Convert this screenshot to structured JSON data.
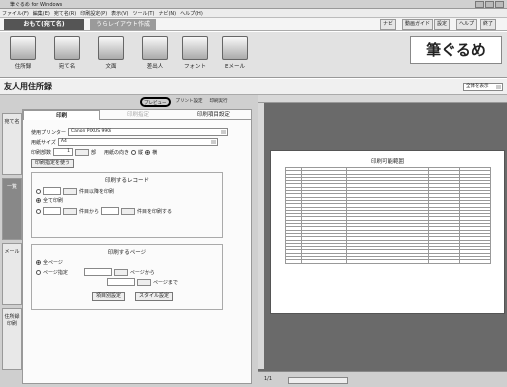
{
  "window": {
    "title": "筆ぐるめ for Windows"
  },
  "menu": [
    "ファイル(F)",
    "編集(E)",
    "宛て名(R)",
    "印刷設定(P)",
    "表示(V)",
    "ツール(T)",
    "ナビ(N)",
    "ヘルプ(H)"
  ],
  "toolbar1": {
    "tab_main": "おもて(宛て名)",
    "tab_layout": "うらレイアウト作成",
    "navi": "ナビ",
    "video": "動画ガイド",
    "settings": "設定",
    "help": "ヘルプ",
    "exit": "終了"
  },
  "toolbar2": {
    "buttons": [
      "住所録",
      "宛て名",
      "文面",
      "差出人",
      "フォント",
      "Eメール"
    ],
    "logo": "筆ぐるめ"
  },
  "header": {
    "page_title": "友人用住所録",
    "show_all": "全体を表示"
  },
  "actions": {
    "preview": "プレビュー",
    "print_layout": "プリント設定",
    "print_run": "印刷実行"
  },
  "side_tabs": [
    "宛て名",
    "一覧",
    "メール",
    "住所録印刷"
  ],
  "panel": {
    "tabs": [
      "印刷",
      "印刷指定",
      "印刷項目設定"
    ],
    "printer_label": "使用プリンター",
    "printer_value": "Canon PIXUS 990i",
    "paper_label": "用紙サイズ",
    "paper_value": "A4",
    "copies_label": "印刷部数",
    "copies_value": "1",
    "copies_unit": "部",
    "orientation_label": "用紙の向き",
    "orientation_options": [
      "縦",
      "横"
    ],
    "print_spec_button": "印刷指定を使う",
    "records_title": "印刷するレコード",
    "rec_option1": "件目以降を印刷",
    "rec_option2": "全て印刷",
    "rec_option3_a": "件目から",
    "rec_option3_b": "件目を印刷する",
    "pages_title": "印刷するページ",
    "page_all": "全ページ",
    "page_spec": "ページ指定",
    "page_from": "ページから",
    "page_to": "ページまで",
    "item_settings_button": "項目別設定",
    "style_settings_button": "スタイル設定"
  },
  "preview": {
    "sheet_title": "印刷可能範囲",
    "page_indicator": "1/1"
  }
}
